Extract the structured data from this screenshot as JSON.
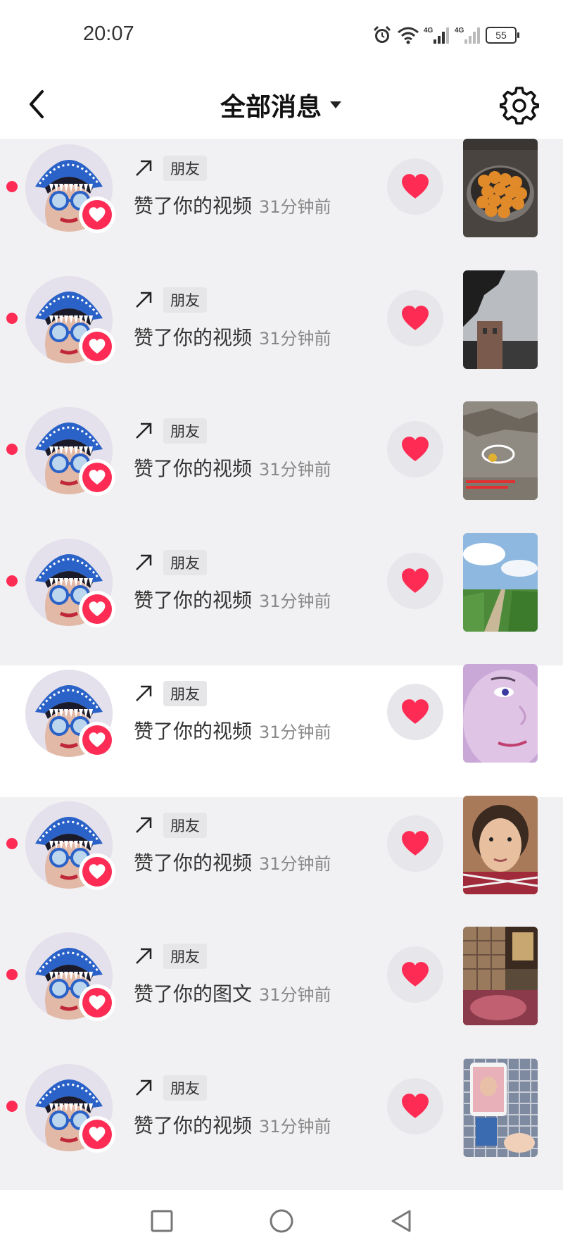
{
  "status_bar": {
    "time": "20:07",
    "battery": "55",
    "icons": [
      "alarm-icon",
      "wifi-icon",
      "signal-4g-icon",
      "signal-4g-icon"
    ]
  },
  "header": {
    "title": "全部消息",
    "back_icon": "chevron-left-icon",
    "dropdown_icon": "caret-down-icon",
    "settings_icon": "gear-icon"
  },
  "notifications": [
    {
      "relation": "朋友",
      "action": "赞了你的视频",
      "time": "31分钟前",
      "unread": true,
      "thumb": "food-pot"
    },
    {
      "relation": "朋友",
      "action": "赞了你的视频",
      "time": "31分钟前",
      "unread": true,
      "thumb": "building-sky"
    },
    {
      "relation": "朋友",
      "action": "赞了你的视频",
      "time": "31分钟前",
      "unread": true,
      "thumb": "ground-circle"
    },
    {
      "relation": "朋友",
      "action": "赞了你的视频",
      "time": "31分钟前",
      "unread": true,
      "thumb": "road-field"
    },
    {
      "relation": "朋友",
      "action": "赞了你的视频",
      "time": "31分钟前",
      "unread": false,
      "thumb": "face-closeup"
    },
    {
      "relation": "朋友",
      "action": "赞了你的视频",
      "time": "31分钟前",
      "unread": true,
      "thumb": "woman-selfie"
    },
    {
      "relation": "朋友",
      "action": "赞了你的图文",
      "time": "31分钟前",
      "unread": true,
      "thumb": "room-interior"
    },
    {
      "relation": "朋友",
      "action": "赞了你的视频",
      "time": "31分钟前",
      "unread": true,
      "thumb": "phone-tiles"
    }
  ],
  "colors": {
    "accent": "#fe2c55",
    "unread_bg": "#f1f0f2",
    "read_bg": "#ffffff"
  },
  "nav_bar": {
    "icons": [
      "recent-apps-square-icon",
      "home-circle-icon",
      "back-triangle-icon"
    ]
  }
}
